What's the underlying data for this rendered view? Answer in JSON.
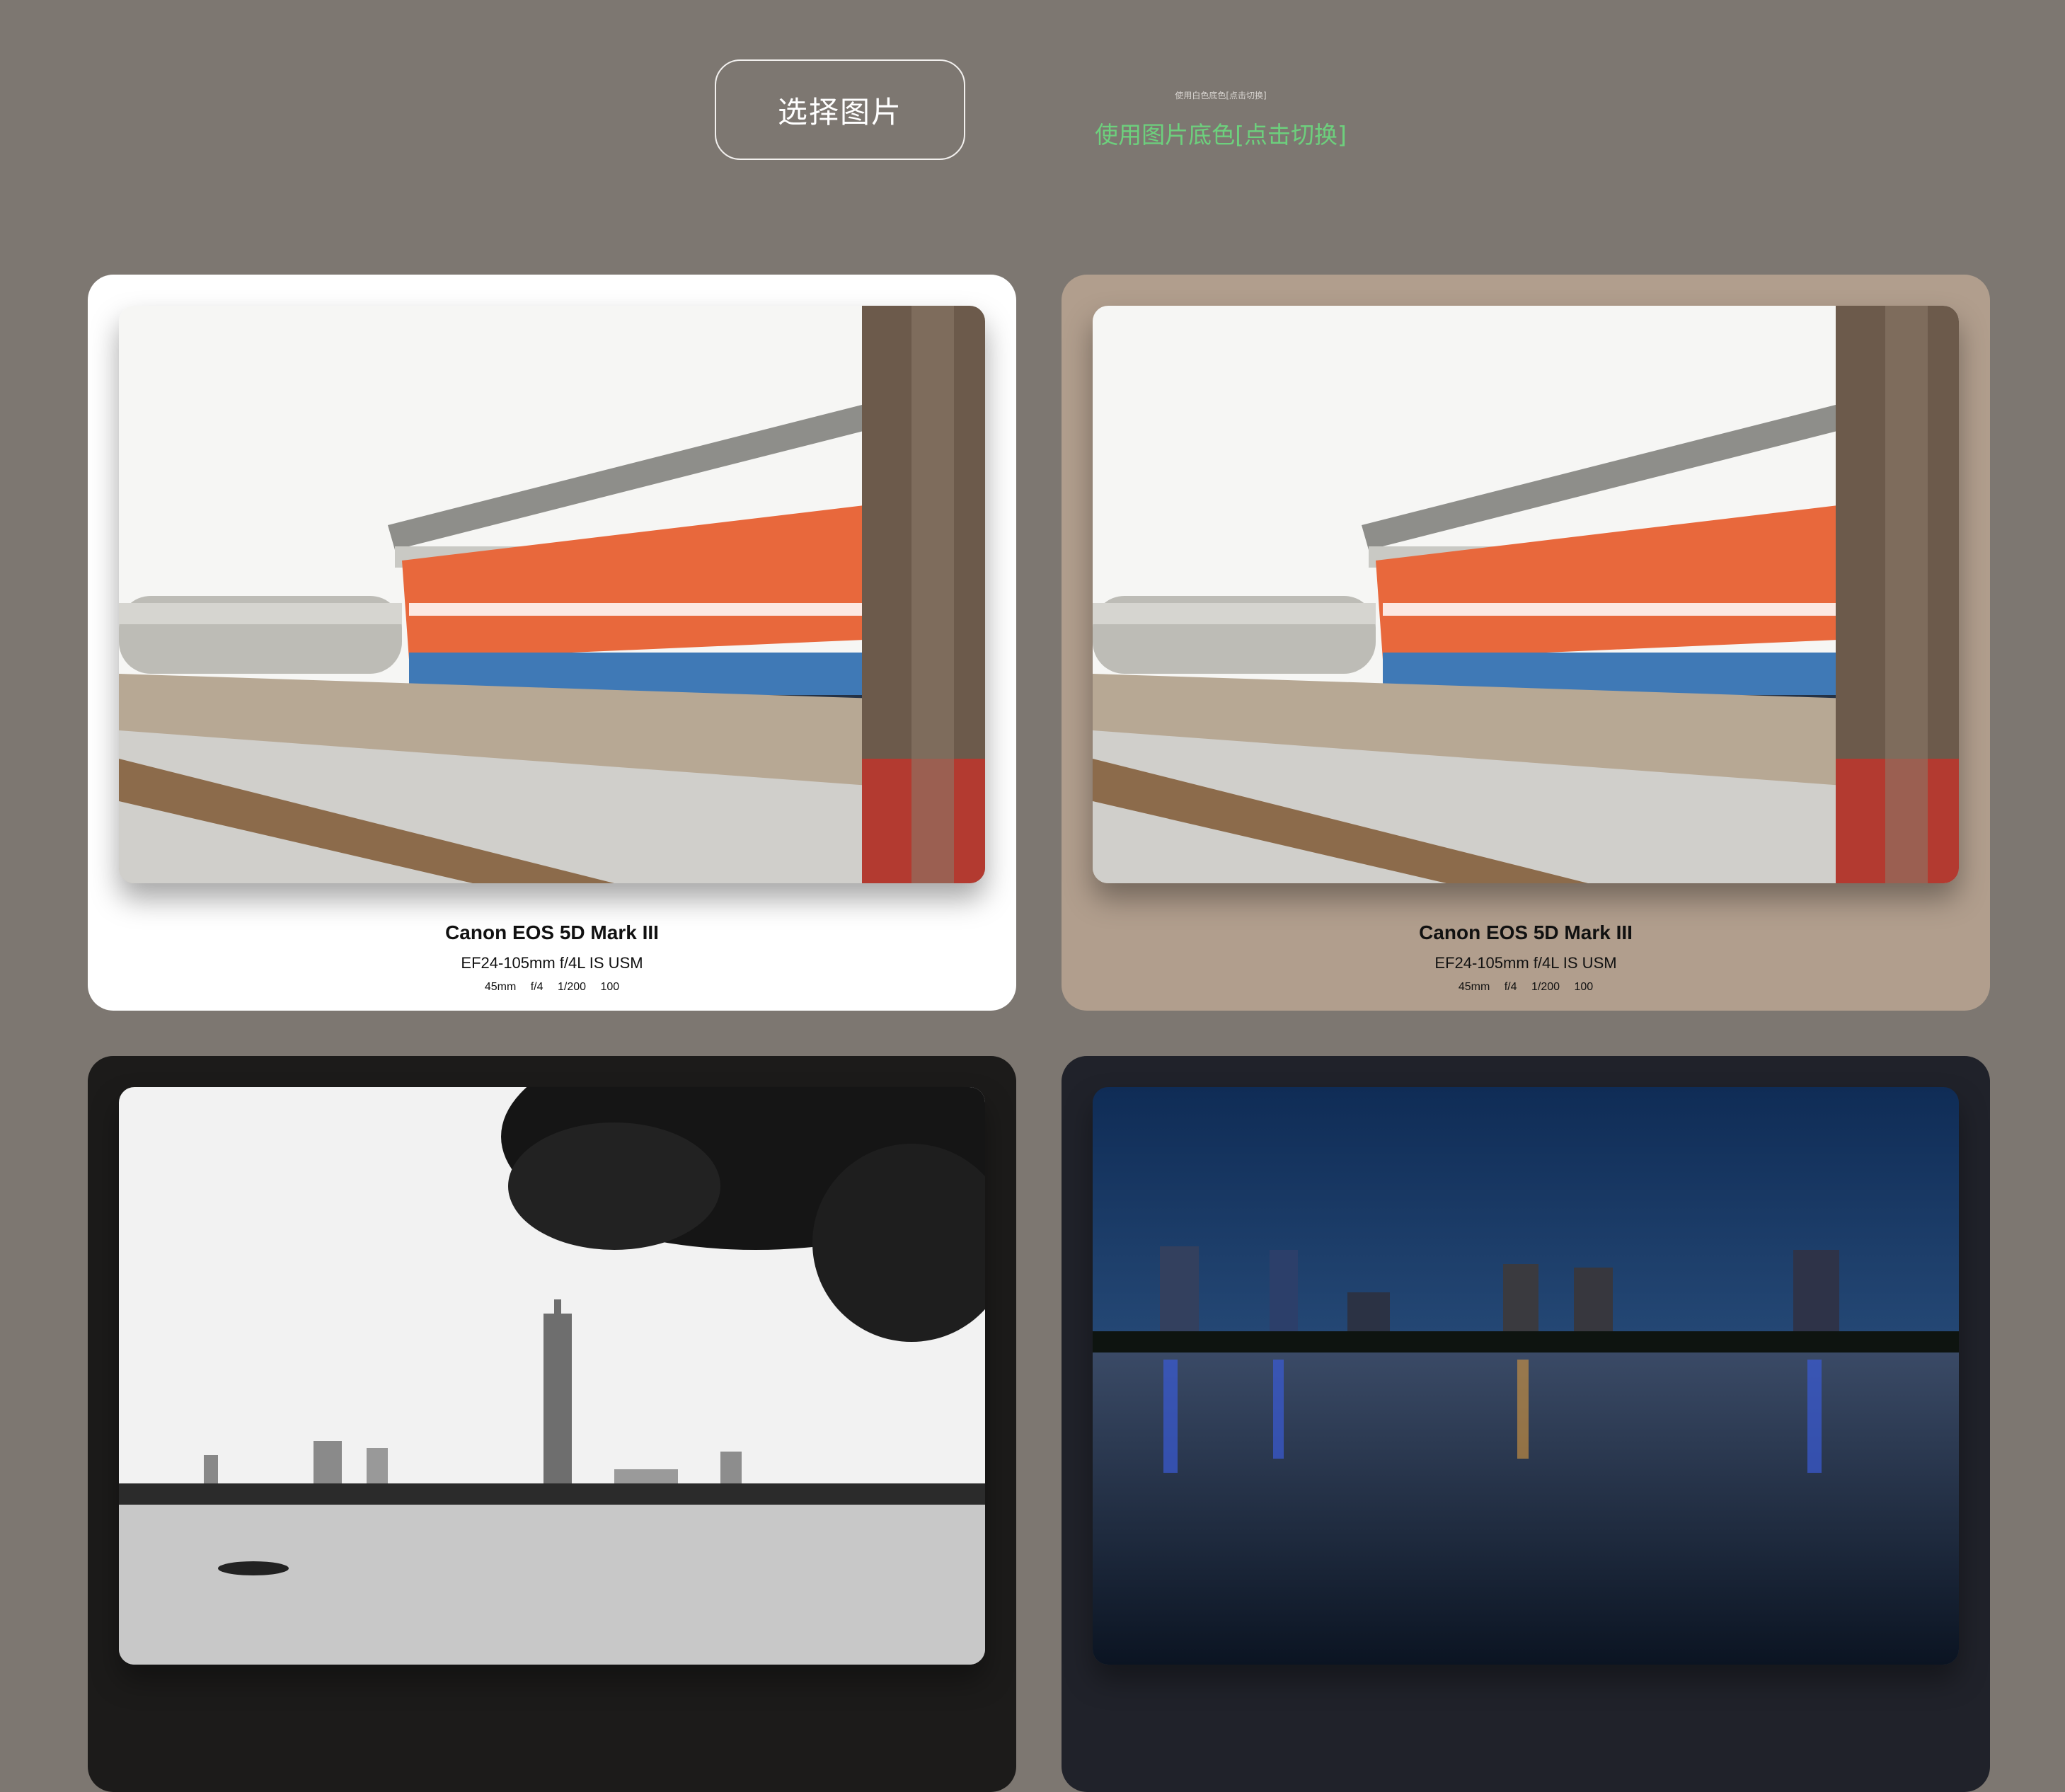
{
  "header": {
    "select_button_label": "选择图片",
    "toggle_hint_small": "使用白色底色[点击切换]",
    "toggle_label": "使用图片底色[点击切换]"
  },
  "colors": {
    "page_background": "#7d7771",
    "toggle_label": "#6dd07d",
    "card1_background": "#ffffff",
    "card2_background": "#b19e8d",
    "card3_background": "#1c1b1a",
    "card4_background": "#20222a"
  },
  "cards": [
    {
      "photo": "train-photo",
      "camera": "Canon EOS 5D Mark III",
      "lens": "EF24-105mm f/4L IS USM",
      "params": {
        "focal": "45mm",
        "aperture": "f/4",
        "shutter": "1/200",
        "iso": "100"
      }
    },
    {
      "photo": "train-photo",
      "camera": "Canon EOS 5D Mark III",
      "lens": "EF24-105mm f/4L IS USM",
      "params": {
        "focal": "45mm",
        "aperture": "f/4",
        "shutter": "1/200",
        "iso": "100"
      }
    },
    {
      "photo": "bw-skyline-photo"
    },
    {
      "photo": "night-skyline-photo"
    }
  ]
}
